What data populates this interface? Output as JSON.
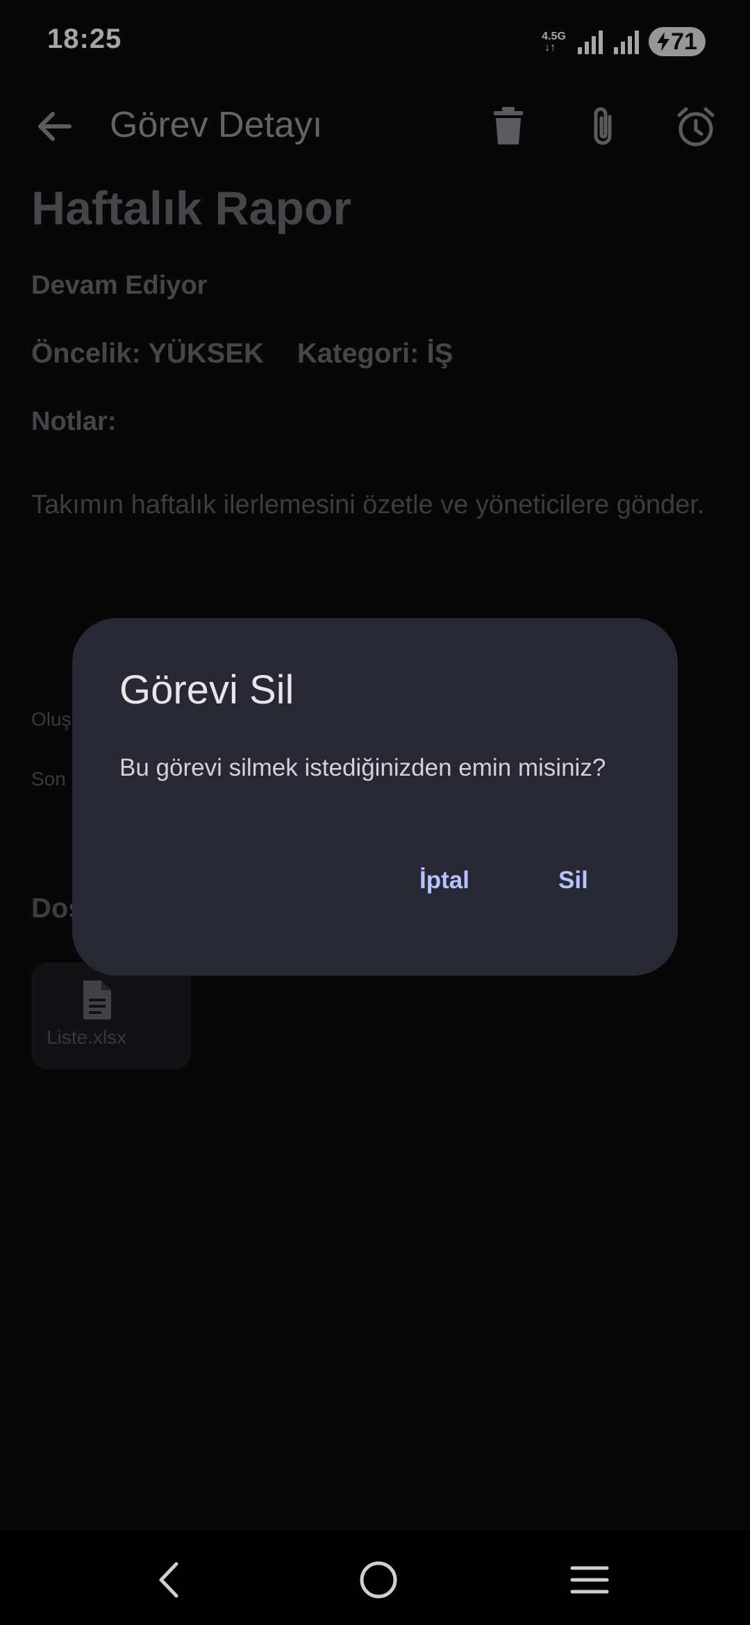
{
  "status_bar": {
    "time": "18:25",
    "network": "4.5G",
    "battery": "71"
  },
  "app_bar": {
    "title": "Görev Detayı",
    "icons": [
      "back-arrow-icon",
      "trash-icon",
      "paperclip-icon",
      "alarm-icon"
    ]
  },
  "task": {
    "title": "Haftalık Rapor",
    "status": "Devam Ediyor",
    "priority": "Öncelik: YÜKSEK",
    "category": "Kategori: İŞ",
    "notes_label": "Notlar:",
    "notes": "Takımın haftalık ilerlemesini özetle ve yöneticilere gönder.",
    "created_partial": "Oluş",
    "updated_partial": "Son",
    "files_partial": "Dos"
  },
  "attachment": {
    "name": "Liste.xlsx",
    "icon": "document-icon"
  },
  "dialog": {
    "title": "Görevi Sil",
    "message": "Bu görevi silmek istediğinizden emin misiniz?",
    "cancel": "İptal",
    "confirm": "Sil"
  },
  "colors": {
    "dialog_bg": "#272834",
    "accent": "#b6c3ff",
    "background": "#0b0b0d"
  }
}
